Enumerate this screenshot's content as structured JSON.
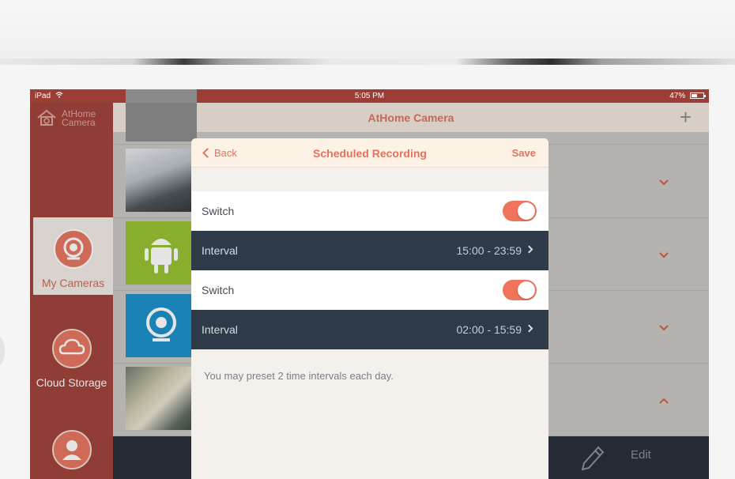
{
  "status_bar": {
    "device": "iPad",
    "time": "5:05 PM",
    "battery": "47%"
  },
  "app": {
    "brand_line1": "AtHome",
    "brand_line2": "Camera",
    "title": "AtHome Camera",
    "plus": "+"
  },
  "sidebar": {
    "items": [
      {
        "label": "My Cameras",
        "icon": "camera-icon",
        "active": true
      },
      {
        "label": "Cloud Storage",
        "icon": "cloud-icon",
        "active": false
      },
      {
        "label": "",
        "icon": "profile-icon",
        "active": false
      }
    ]
  },
  "camera_list": {
    "rows": [
      {
        "thumb": "partial-camera-thumbnail",
        "chevron": ""
      },
      {
        "thumb": "office-ceiling-photo",
        "chevron": "down"
      },
      {
        "thumb": "android-logo",
        "chevron": "down"
      },
      {
        "thumb": "webcam-logo",
        "chevron": "down"
      },
      {
        "thumb": "desk-cups-photo",
        "chevron": "up"
      }
    ],
    "edit_label": "Edit"
  },
  "modal": {
    "back_label": "Back",
    "title": "Scheduled Recording",
    "save_label": "Save",
    "schedules": [
      {
        "switch_label": "Switch",
        "enabled": true,
        "interval_label": "Interval",
        "interval_value": "15:00 - 23:59"
      },
      {
        "switch_label": "Switch",
        "enabled": true,
        "interval_label": "Interval",
        "interval_value": "02:00 - 15:59"
      }
    ],
    "note": "You may preset 2 time intervals each day."
  },
  "colors": {
    "accent": "#e5725d",
    "sidebar": "#9f4037",
    "interval_row": "#2f3a49"
  }
}
